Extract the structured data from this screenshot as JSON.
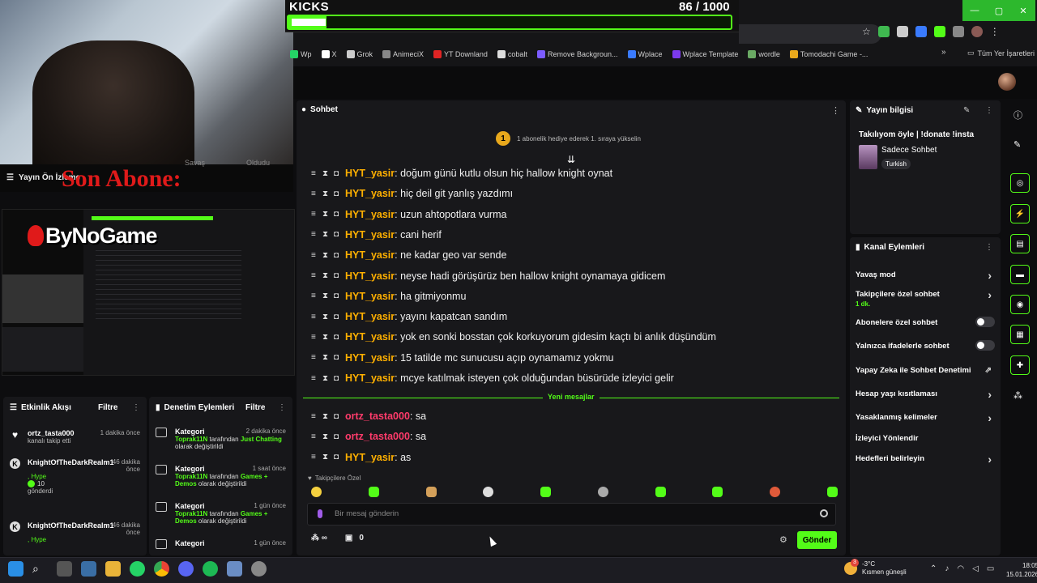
{
  "goal": {
    "title": "KICKS",
    "current": "86",
    "total": "/ 1000",
    "progress": 0.086
  },
  "window_buttons": [
    "—",
    "▢",
    "✕"
  ],
  "bookmarks": [
    {
      "label": "Wp",
      "color": "#25d366"
    },
    {
      "label": "X",
      "color": "#ffffff"
    },
    {
      "label": "Grok",
      "color": "#cccccc"
    },
    {
      "label": "AnimeciX",
      "color": "#888888"
    },
    {
      "label": "YT Downland",
      "color": "#e02424"
    },
    {
      "label": "cobalt",
      "color": "#dddddd"
    },
    {
      "label": "Remove Backgroun...",
      "color": "#7c5cff"
    },
    {
      "label": "Wplace",
      "color": "#3a7bff"
    },
    {
      "label": "Wplace Template",
      "color": "#7c3aed"
    },
    {
      "label": "wordle",
      "color": "#6aaa64"
    },
    {
      "label": "Tomodachi Game -...",
      "color": "#e8a81c"
    }
  ],
  "bookmarks_more": "»",
  "bookmarks_all": "Tüm Yer İşaretleri",
  "stream": {
    "son_abone": "Son Abone:",
    "preview_label": "Yayın Ön İzleme",
    "overlay_logo": "ByNoGame",
    "cam_caption_1": "Savaş",
    "cam_caption_2": "Oldudu"
  },
  "activity": {
    "title": "Etkinlik Akışı",
    "filter": "Filtre",
    "items": [
      {
        "name": "ortz_tasta000",
        "sub": "kanalı takip etti",
        "time": "1 dakika önce"
      },
      {
        "name": "KnightOfTheDarkRealm1",
        "sub": ", Hype",
        "extra": "10",
        "extra2": "gönderdi",
        "time": "46 dakika önce"
      },
      {
        "name": "KnightOfTheDarkRealm1",
        "sub": ", Hype",
        "time": "46 dakika önce"
      }
    ]
  },
  "moderation": {
    "title": "Denetim Eylemleri",
    "filter": "Filtre",
    "items": [
      {
        "k": "Kategori",
        "time": "2 dakika önce",
        "who": "Toprak11N",
        "mid": "tarafından",
        "cat": "Just Chatting",
        "end": "olarak değiştirildi"
      },
      {
        "k": "Kategori",
        "time": "1 saat önce",
        "who": "Toprak11N",
        "mid": "tarafından",
        "cat": "Games + Demos",
        "end": "olarak değiştirildi"
      },
      {
        "k": "Kategori",
        "time": "1 gün önce",
        "who": "Toprak11N",
        "mid": "tarafından",
        "cat": "Games + Demos",
        "end": "olarak değiştirildi"
      },
      {
        "k": "Kategori",
        "time": "1 gün önce"
      }
    ]
  },
  "chat": {
    "title": "Sohbet",
    "pinned_badge": "1",
    "pinned_text": "1 abonelik hediye ederek 1. sıraya yükselin",
    "messages": [
      {
        "user": "HYT_yasir",
        "text": "doğum günü kutlu olsun hiç hallow knight oynat",
        "c": "u1"
      },
      {
        "user": "HYT_yasir",
        "text": "hiç deil git yanlış yazdımı",
        "c": "u1"
      },
      {
        "user": "HYT_yasir",
        "text": "uzun ahtopotlara vurma",
        "c": "u1"
      },
      {
        "user": "HYT_yasir",
        "text": "cani herif",
        "c": "u1"
      },
      {
        "user": "HYT_yasir",
        "text": "ne kadar geo var sende",
        "c": "u1"
      },
      {
        "user": "HYT_yasir",
        "text": "neyse hadi görüşürüz ben hallow knight oynamaya gidicem",
        "c": "u1"
      },
      {
        "user": "HYT_yasir",
        "text": "ha gitmiyonmu",
        "c": "u1"
      },
      {
        "user": "HYT_yasir",
        "text": "yayını kapatcan sandım",
        "c": "u1"
      },
      {
        "user": "HYT_yasir",
        "text": "yok en sonki bosstan çok korkuyorum gidesim kaçtı bi anlık düşündüm",
        "c": "u1"
      },
      {
        "user": "HYT_yasir",
        "text": "15 tatilde mc sunucusu açıp oynamamız yokmu",
        "c": "u1"
      },
      {
        "user": "HYT_yasir",
        "text": "mcye katılmak isteyen çok olduğundan büsürüde izleyici gelir",
        "c": "u1"
      }
    ],
    "new_label": "Yeni mesajlar",
    "new_messages": [
      {
        "user": "ortz_tasta000",
        "text": "sa",
        "c": "u2"
      },
      {
        "user": "ortz_tasta000",
        "text": "sa",
        "c": "u2"
      },
      {
        "user": "HYT_yasir",
        "text": "as",
        "c": "u1"
      }
    ],
    "followers_only": "Takipçilere Özel",
    "placeholder": "Bir mesaj gönderin",
    "points": "0",
    "send": "Gönder"
  },
  "info": {
    "title": "Yayın bilgisi",
    "stream_title": "Takılıyom öyle | !donate !insta",
    "category": "Sadece Sohbet",
    "tag": "Turkish"
  },
  "actions": {
    "title": "Kanal Eylemleri",
    "items": [
      {
        "label": "Yavaş mod",
        "type": "arrow"
      },
      {
        "label": "Takipçilere özel sohbet",
        "sub": "1 dk.",
        "type": "arrow"
      },
      {
        "label": "Abonelere özel sohbet",
        "type": "toggle"
      },
      {
        "label": "Yalnızca ifadelerle sohbet",
        "type": "toggle"
      },
      {
        "label": "Yapay Zeka ile Sohbet Denetimi",
        "type": "ext"
      },
      {
        "label": "Hesap yaşı kısıtlaması",
        "type": "arrow"
      },
      {
        "label": "Yasaklanmış kelimeler",
        "type": "arrow"
      },
      {
        "label": "İzleyici Yönlendir",
        "type": "none"
      },
      {
        "label": "Hedefleri belirleyin",
        "type": "arrow"
      }
    ]
  },
  "taskbar": {
    "weather_temp": "-3°C",
    "weather_desc": "Kısmen güneşli",
    "weather_badge": "3",
    "time": "18:05",
    "date": "15.01.2026"
  },
  "colors": {
    "accent": "#53fc18",
    "user_gold": "#ffb000",
    "user_red": "#ff3b6b"
  }
}
